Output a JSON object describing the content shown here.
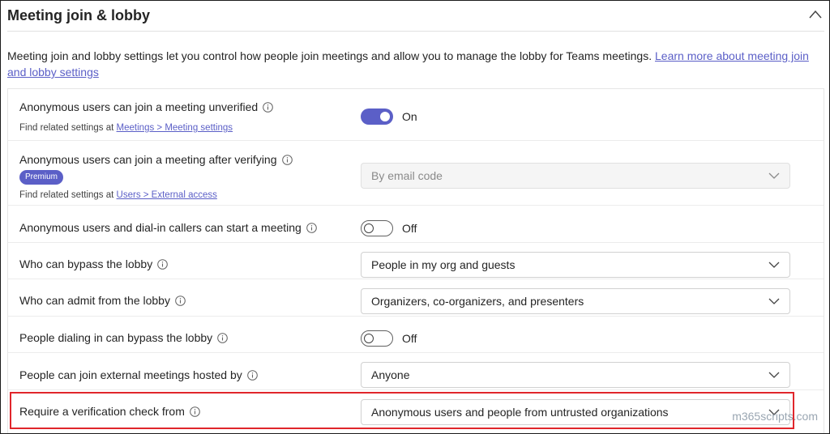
{
  "section": {
    "title": "Meeting join & lobby"
  },
  "description": {
    "text": "Meeting join and lobby settings let you control how people join meetings and allow you to manage the lobby for Teams meetings. ",
    "link": "Learn more about meeting join and lobby settings"
  },
  "settings": [
    {
      "label": "Anonymous users can join a meeting unverified",
      "note_prefix": "Find related settings at ",
      "note_link": "Meetings > Meeting settings",
      "control": "toggle",
      "state": "On"
    },
    {
      "label": "Anonymous users can join a meeting after verifying",
      "badge": "Premium",
      "note_prefix": "Find related settings at ",
      "note_link": "Users > External access",
      "control": "dropdown",
      "value": "By email code",
      "disabled": true
    },
    {
      "label": "Anonymous users and dial-in callers can start a meeting",
      "control": "toggle",
      "state": "Off"
    },
    {
      "label": "Who can bypass the lobby",
      "control": "dropdown",
      "value": "People in my org and guests"
    },
    {
      "label": "Who can admit from the lobby",
      "control": "dropdown",
      "value": "Organizers, co-organizers, and presenters"
    },
    {
      "label": "People dialing in can bypass the lobby",
      "control": "toggle",
      "state": "Off"
    },
    {
      "label": "People can join external meetings hosted by",
      "control": "dropdown",
      "value": "Anyone"
    },
    {
      "label": "Require a verification check from",
      "control": "dropdown",
      "value": "Anonymous users and people from untrusted organizations"
    }
  ],
  "watermark": "m365scripts.com",
  "colors": {
    "accent": "#5b5fc7",
    "highlight": "#e0262b"
  },
  "icons": {
    "collapse": "chevron-up-icon",
    "info": "info-icon",
    "dropdown": "chevron-down-icon"
  }
}
